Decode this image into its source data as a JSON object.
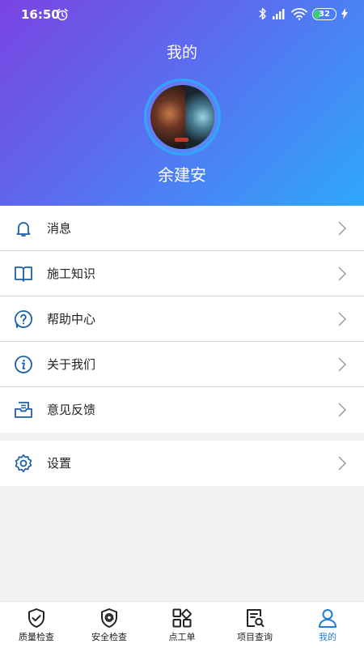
{
  "status_bar": {
    "time": "16:50",
    "battery_level": "32"
  },
  "header": {
    "title": "我的",
    "username": "余建安"
  },
  "menu": {
    "items": [
      {
        "label": "消息",
        "icon": "bell-icon"
      },
      {
        "label": "施工知识",
        "icon": "book-icon"
      },
      {
        "label": "帮助中心",
        "icon": "help-icon"
      },
      {
        "label": "关于我们",
        "icon": "info-icon"
      },
      {
        "label": "意见反馈",
        "icon": "feedback-icon"
      }
    ]
  },
  "settings": {
    "label": "设置",
    "icon": "gear-icon"
  },
  "tabbar": {
    "tabs": [
      {
        "label": "质量检查",
        "icon": "shield-check-icon"
      },
      {
        "label": "安全检查",
        "icon": "shield-at-icon"
      },
      {
        "label": "点工单",
        "icon": "grid-icon"
      },
      {
        "label": "项目查询",
        "icon": "document-search-icon"
      },
      {
        "label": "我的",
        "icon": "user-icon",
        "active": true
      }
    ]
  },
  "colors": {
    "accent": "#1f7fd8",
    "icon_blue": "#1a5fa8",
    "gradient_start": "#7a44e2",
    "gradient_end": "#2ea8fa"
  }
}
